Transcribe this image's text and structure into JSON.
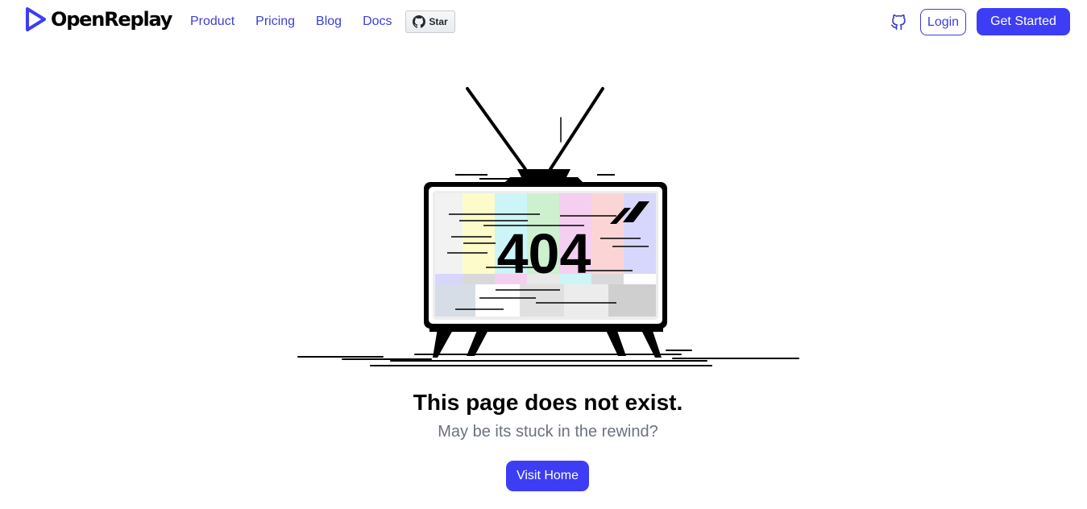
{
  "header": {
    "brand_name": "OpenReplay",
    "nav": {
      "product": "Product",
      "pricing": "Pricing",
      "blog": "Blog",
      "docs": "Docs"
    },
    "star_label": "Star",
    "github_icon": "github-icon",
    "login_label": "Login",
    "get_started_label": "Get Started"
  },
  "main": {
    "error_code": "404",
    "headline": "This page does not exist.",
    "subline": "May be its stuck in the rewind?",
    "visit_home_label": "Visit Home"
  },
  "colors": {
    "accent": "#3d3df5",
    "link": "#3c3fd8",
    "muted_text": "#6b7280"
  }
}
